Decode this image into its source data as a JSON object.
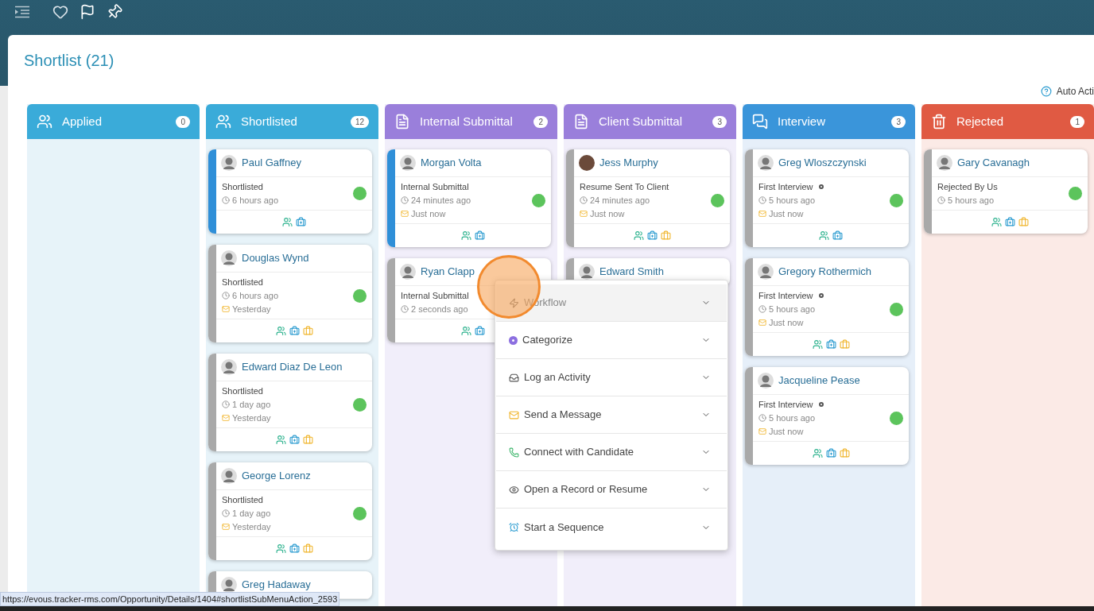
{
  "title": "Shortlist (21)",
  "auto_actions": "Auto Acti",
  "columns": [
    {
      "name": "Applied",
      "count": "0",
      "kind": "people"
    },
    {
      "name": "Shortlisted",
      "count": "12",
      "kind": "people",
      "cards": [
        {
          "name": "Paul Gaffney",
          "photo": false,
          "highlighted": true,
          "status": "Shortlisted",
          "marker": false,
          "time": "6 hours ago",
          "actions": [
            {
              "kind": "people"
            },
            {
              "kind": "medkit"
            }
          ]
        },
        {
          "name": "Douglas Wynd",
          "photo": false,
          "highlighted": false,
          "status": "Shortlisted",
          "marker": false,
          "time": "6 hours ago",
          "message": "Yesterday",
          "actions": [
            {
              "kind": "people"
            },
            {
              "kind": "medkit"
            },
            {
              "kind": "briefcase"
            }
          ]
        },
        {
          "name": "Edward Diaz De Leon",
          "photo": false,
          "highlighted": false,
          "status": "Shortlisted",
          "marker": false,
          "time": "1 day ago",
          "message": "Yesterday",
          "actions": [
            {
              "kind": "people"
            },
            {
              "kind": "medkit"
            },
            {
              "kind": "briefcase"
            }
          ]
        },
        {
          "name": "George Lorenz",
          "photo": false,
          "highlighted": false,
          "status": "Shortlisted",
          "marker": false,
          "time": "1 day ago",
          "message": "Yesterday",
          "actions": [
            {
              "kind": "people"
            },
            {
              "kind": "medkit"
            },
            {
              "kind": "briefcase"
            }
          ]
        },
        {
          "name": "Greg Hadaway",
          "photo": false,
          "highlighted": false
        }
      ]
    },
    {
      "name": "Internal Submittal",
      "count": "2",
      "kind": "document",
      "cards": [
        {
          "name": "Morgan Volta",
          "photo": false,
          "highlighted": true,
          "status": "Internal Submittal",
          "marker": false,
          "time": "24 minutes ago",
          "message": "Just now",
          "actions": [
            {
              "kind": "people"
            },
            {
              "kind": "medkit"
            }
          ]
        },
        {
          "name": "Ryan Clapp",
          "photo": false,
          "highlighted": false,
          "status": "Internal Submittal",
          "marker": false,
          "time": "2 seconds ago",
          "actions": [
            {
              "kind": "people"
            },
            {
              "kind": "medkit"
            }
          ]
        }
      ]
    },
    {
      "name": "Client Submittal",
      "count": "3",
      "kind": "document",
      "cards": [
        {
          "name": "Jess Murphy",
          "photo": true,
          "highlighted": false,
          "status": "Resume Sent To Client",
          "marker": false,
          "time": "24 minutes ago",
          "message": "Just now",
          "actions": [
            {
              "kind": "people"
            },
            {
              "kind": "medkit"
            },
            {
              "kind": "briefcase"
            }
          ]
        },
        {
          "name": "Edward Smith",
          "photo": false,
          "highlighted": false
        }
      ]
    },
    {
      "name": "Interview",
      "count": "3",
      "kind": "chat",
      "cards": [
        {
          "name": "Greg Wloszczynski",
          "photo": false,
          "highlighted": false,
          "status": "First Interview",
          "marker": true,
          "time": "5 hours ago",
          "message": "Just now",
          "actions": [
            {
              "kind": "people"
            },
            {
              "kind": "medkit"
            }
          ]
        },
        {
          "name": "Gregory Rothermich",
          "photo": false,
          "highlighted": false,
          "status": "First Interview",
          "marker": true,
          "time": "5 hours ago",
          "message": "Just now",
          "actions": [
            {
              "kind": "people"
            },
            {
              "kind": "medkit"
            },
            {
              "kind": "briefcase"
            }
          ]
        },
        {
          "name": "Jacqueline Pease",
          "photo": false,
          "highlighted": false,
          "status": "First Interview",
          "marker": true,
          "time": "5 hours ago",
          "message": "Just now",
          "actions": [
            {
              "kind": "people"
            },
            {
              "kind": "medkit"
            },
            {
              "kind": "briefcase"
            }
          ]
        }
      ]
    },
    {
      "name": "Rejected",
      "count": "1",
      "kind": "trash",
      "cards": [
        {
          "name": "Gary Cavanagh",
          "photo": false,
          "highlighted": false,
          "status": "Rejected By Us",
          "marker": false,
          "time": "5 hours ago",
          "actions": [
            {
              "kind": "people"
            },
            {
              "kind": "medkit"
            },
            {
              "kind": "briefcase"
            }
          ]
        }
      ]
    }
  ],
  "menu": [
    {
      "label": "Workflow",
      "kind": "bolt",
      "selected": true
    },
    {
      "label": "Categorize",
      "kind": "dot",
      "selected": false
    },
    {
      "label": "Log an Activity",
      "kind": "inbox",
      "selected": false
    },
    {
      "label": "Send a Message",
      "kind": "mail",
      "selected": false
    },
    {
      "label": "Connect with Candidate",
      "kind": "phone",
      "selected": false
    },
    {
      "label": "Open a Record or Resume",
      "kind": "eye",
      "selected": false
    },
    {
      "label": "Start a Sequence",
      "kind": "alarm",
      "selected": false
    }
  ],
  "status_url": "https://evous.tracker-rms.com/Opportunity/Details/1404#shortlistSubMenuAction_2593"
}
